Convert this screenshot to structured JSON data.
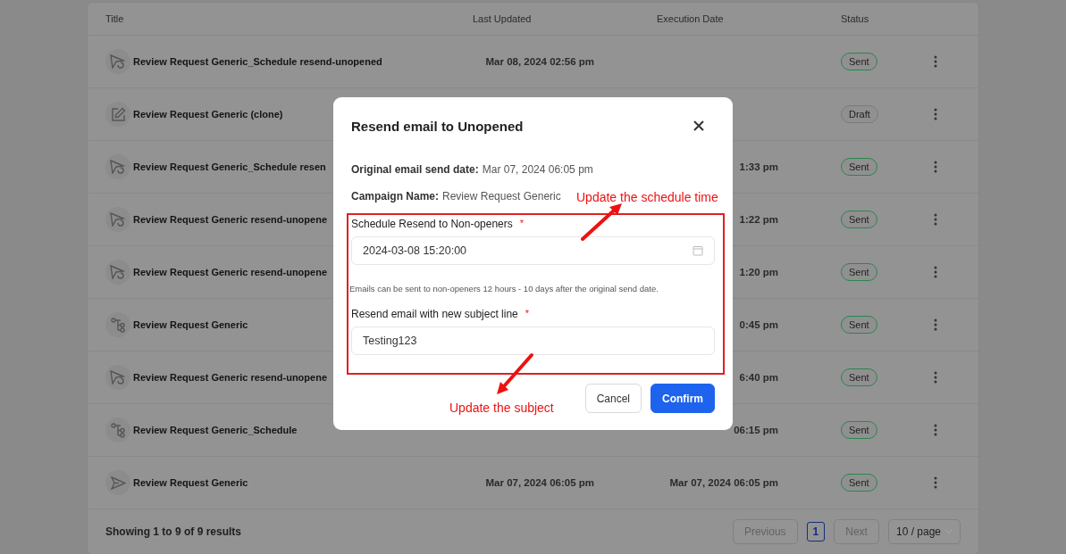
{
  "table": {
    "columns": [
      "Title",
      "Last Updated",
      "Execution Date",
      "Status"
    ],
    "rows": [
      {
        "kind": "resend",
        "title": "Review Request Generic_Schedule resend-unopened",
        "last_updated": "Mar 08, 2024 02:56 pm",
        "status": "Sent",
        "color": "#27884a"
      },
      {
        "kind": "edit",
        "title": "Review Request Generic (clone)",
        "status": "Draft",
        "color": "#7b7b7d"
      },
      {
        "kind": "resend",
        "title": "Review Request Generic_Schedule resen",
        "execution_date": "1:33 pm",
        "status": "Sent",
        "color": "#27884a"
      },
      {
        "kind": "resend",
        "title": "Review Request Generic resend-unopene",
        "execution_date": "1:22 pm",
        "status": "Sent",
        "color": "#27884a"
      },
      {
        "kind": "resend",
        "title": "Review Request Generic resend-unopene",
        "execution_date": "1:20 pm",
        "status": "Sent",
        "color": "#27884a"
      },
      {
        "kind": "flow",
        "title": "Review Request Generic",
        "execution_date": "0:45 pm",
        "status": "Sent",
        "color": "#27884a"
      },
      {
        "kind": "resend",
        "title": "Review Request Generic resend-unopene",
        "execution_date": "6:40 pm",
        "status": "Sent",
        "color": "#27884a"
      },
      {
        "kind": "flow",
        "title": "Review Request Generic_Schedule",
        "execution_date": "06:15 pm",
        "status": "Sent",
        "color": "#27884a"
      },
      {
        "kind": "send",
        "title": "Review Request Generic",
        "last_updated": "Mar 07, 2024 06:05 pm",
        "execution_date": "Mar 07, 2024 06:05 pm",
        "status": "Sent",
        "color": "#27884a"
      }
    ]
  },
  "footer": {
    "summary": "Showing 1 to 9 of 9 results",
    "previous": {
      "label": "Previous",
      "disabled": true
    },
    "pages": [
      {
        "label": "1",
        "selected": true
      }
    ],
    "next": {
      "label": "Next",
      "disabled": true
    },
    "page_size": "10 / page"
  },
  "modal": {
    "title": "Resend email to Unopened",
    "info": [
      {
        "label": "Original email send date:",
        "value": "Mar 07, 2024 06:05 pm"
      },
      {
        "label": "Campaign Name:",
        "value": "Review Request Generic"
      }
    ],
    "schedule": {
      "label": "Schedule Resend to Non-openers",
      "required_mark": "*",
      "value": "2024-03-08 15:20:00"
    },
    "hint": "Emails can be sent to non-openers 12 hours - 10 days after the original send date.",
    "subject": {
      "label": "Resend email with new subject line",
      "required_mark": "*",
      "value": "Testing123"
    },
    "buttons": [
      {
        "label": "Cancel",
        "kind": "secondary"
      },
      {
        "label": "Confirm",
        "kind": "primary"
      }
    ]
  },
  "annotations": [
    {
      "text": "Update the schedule time"
    },
    {
      "text": "Update the subject"
    }
  ]
}
